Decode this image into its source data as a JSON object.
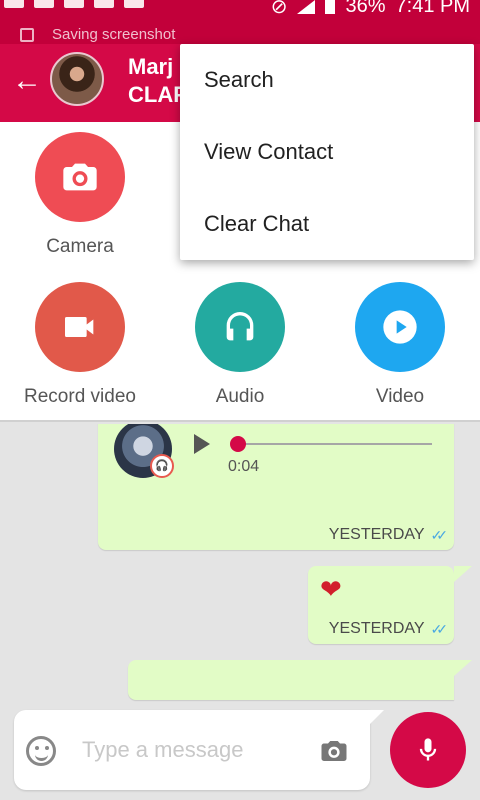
{
  "status_bar": {
    "battery": "36%",
    "time": "7:41 PM"
  },
  "notification": {
    "text": "Saving screenshot"
  },
  "header": {
    "contact_name": "Marj",
    "contact_sub": "CLAP"
  },
  "menu": {
    "items": [
      {
        "label": "Search"
      },
      {
        "label": "View Contact"
      },
      {
        "label": "Clear Chat"
      }
    ]
  },
  "attachments": {
    "items": [
      {
        "label": "Camera",
        "icon": "camera-icon",
        "color": "#ef4c54"
      },
      {
        "label": "Record video",
        "icon": "videocam-icon",
        "color": "#e1594a"
      },
      {
        "label": "Audio",
        "icon": "headphones-icon",
        "color": "#23aaa0"
      },
      {
        "label": "Video",
        "icon": "play-circle-icon",
        "color": "#1ea7f0"
      }
    ]
  },
  "messages": [
    {
      "type": "voice",
      "duration": "0:04",
      "time": "YESTERDAY"
    },
    {
      "type": "emoji",
      "content": "❤",
      "time": "YESTERDAY"
    }
  ],
  "composer": {
    "placeholder": "Type a message"
  },
  "colors": {
    "primary": "#d40947",
    "bubble": "#e2fcc6",
    "read_ticks": "#4aa8e2"
  }
}
